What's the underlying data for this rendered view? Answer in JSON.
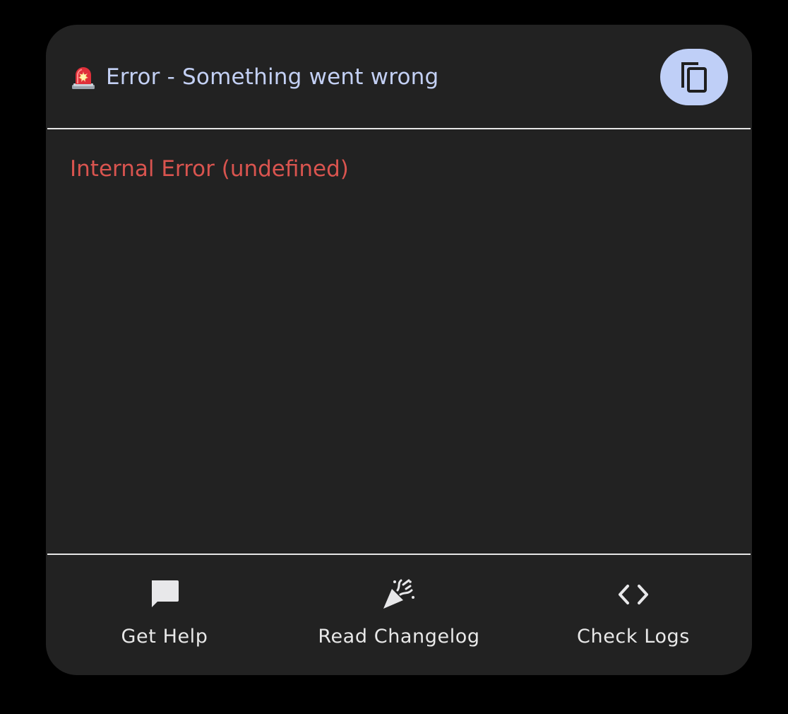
{
  "dialog": {
    "title_icon": "police-car-light-icon",
    "title": "Error - Something went wrong",
    "copy_icon": "copy-icon",
    "error_message": "Internal Error (undefined)",
    "accent_color": "#bfcff7",
    "error_color": "#d9544f"
  },
  "actions": [
    {
      "icon": "chat-bubble-icon",
      "label": "Get Help"
    },
    {
      "icon": "party-popper-icon",
      "label": "Read Changelog"
    },
    {
      "icon": "code-brackets-icon",
      "label": "Check Logs"
    }
  ]
}
